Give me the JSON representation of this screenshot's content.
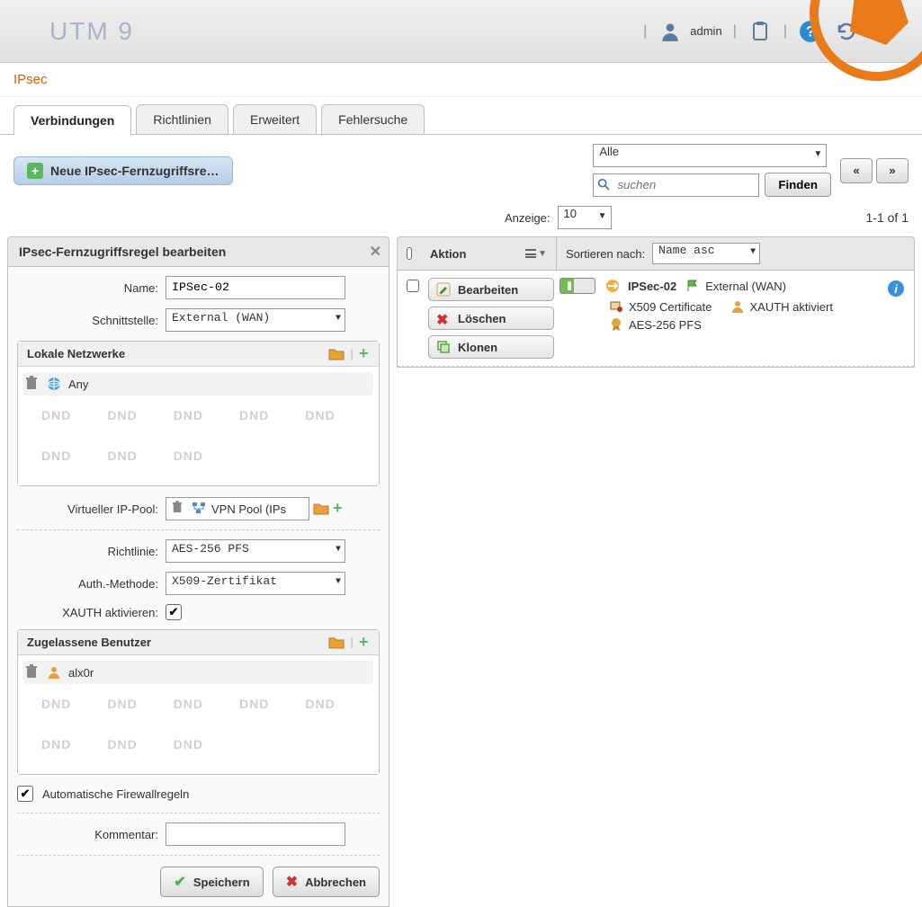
{
  "header": {
    "logo": "UTM 9",
    "user": "admin"
  },
  "breadcrumb": "IPsec",
  "tabs": [
    {
      "label": "Verbindungen",
      "active": true
    },
    {
      "label": "Richtlinien"
    },
    {
      "label": "Erweitert"
    },
    {
      "label": "Fehlersuche"
    }
  ],
  "toolbar": {
    "new_button": "Neue IPsec-Fernzugriffsre…",
    "filter_value": "Alle",
    "search_placeholder": "suchen",
    "find_button": "Finden",
    "display_label": "Anzeige:",
    "display_value": "10",
    "page_info": "1-1 of 1"
  },
  "edit_panel": {
    "title": "IPsec-Fernzugriffsregel bearbeiten",
    "labels": {
      "name": "Name:",
      "interface": "Schnittstelle:",
      "local_networks": "Lokale Netzwerke",
      "virtual_ip_pool": "Virtueller IP-Pool:",
      "policy": "Richtlinie:",
      "auth_method": "Auth.-Methode:",
      "xauth_enable": "XAUTH aktivieren:",
      "allowed_users": "Zugelassene Benutzer",
      "auto_fw": "Automatische Firewallregeln",
      "comment": "Kommentar:"
    },
    "values": {
      "name": "IPSec-02",
      "interface": "External (WAN)",
      "local_net_entry": "Any",
      "virtual_ip_pool": "VPN Pool (IPs",
      "policy": "AES-256 PFS",
      "auth_method": "X509-Zertifikat",
      "allowed_user_entry": "alx0r",
      "comment": "",
      "xauth_checked": true,
      "auto_fw_checked": true
    },
    "dnd_placeholder": "DND",
    "buttons": {
      "save": "Speichern",
      "cancel": "Abbrechen"
    }
  },
  "list": {
    "header": {
      "action": "Aktion",
      "sort_label": "Sortieren nach:",
      "sort_value": "Name asc"
    },
    "row_actions": {
      "edit": "Bearbeiten",
      "delete": "Löschen",
      "clone": "Klonen"
    },
    "items": [
      {
        "enabled": true,
        "name": "IPSec-02",
        "interface": "External (WAN)",
        "auth": "X509 Certificate",
        "xauth": "XAUTH aktiviert",
        "policy": "AES-256 PFS"
      }
    ]
  }
}
